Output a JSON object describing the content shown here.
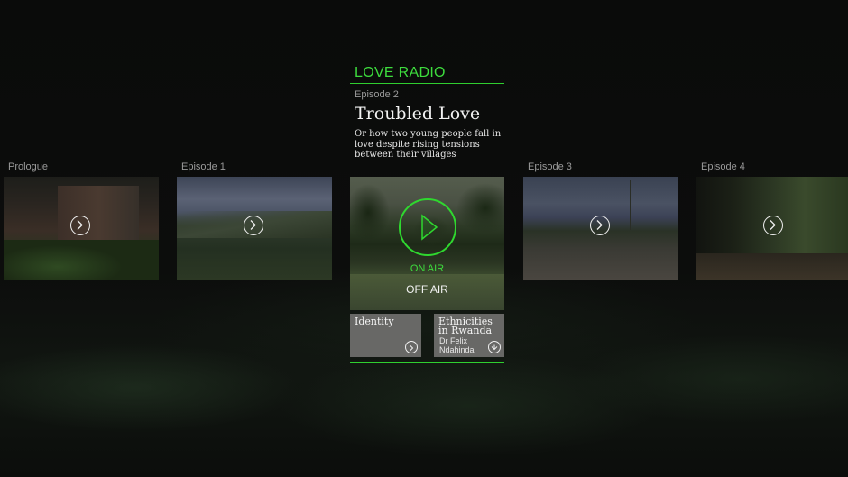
{
  "brand": "LOVE RADIO",
  "current_episode": {
    "label": "Episode 2",
    "title": "Troubled Love",
    "description": "Or how two young people fall in love despite rising tensions between their villages"
  },
  "episodes": [
    {
      "label": "Prologue"
    },
    {
      "label": "Episode 1"
    },
    {
      "label": "Episode 3"
    },
    {
      "label": "Episode 4"
    }
  ],
  "player": {
    "on_air": "ON AIR",
    "off_air": "OFF AIR"
  },
  "extras": [
    {
      "title": "Identity",
      "subtitle": ""
    },
    {
      "title": "Ethnicities in Rwanda",
      "subtitle": "Dr Felix Ndahinda"
    }
  ],
  "icons": {
    "play": "play-circle-icon",
    "arrow_right": "arrow-right-circle-icon",
    "arrow_down": "arrow-down-circle-icon"
  },
  "colors": {
    "accent": "#2fd82f",
    "background": "#0b0c0b"
  }
}
